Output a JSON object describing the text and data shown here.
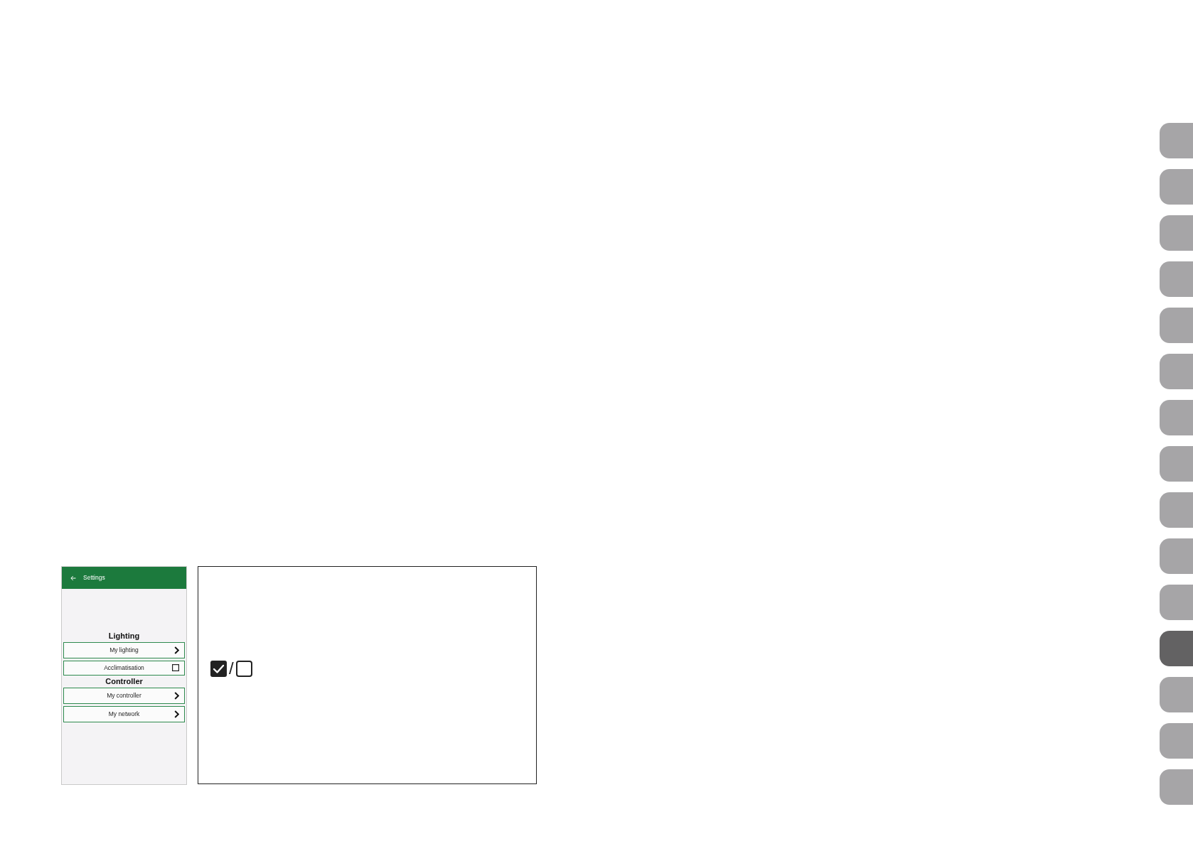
{
  "phone_screen": {
    "header": {
      "title": "Settings"
    },
    "sections": [
      {
        "heading": "Lighting",
        "items": [
          {
            "kind": "link",
            "label": "My lighting"
          },
          {
            "kind": "checkbox",
            "label": "Acclimatisation",
            "checked": false
          }
        ]
      },
      {
        "heading": "Controller",
        "items": [
          {
            "kind": "link",
            "label": "My controller"
          },
          {
            "kind": "link",
            "label": "My network"
          }
        ]
      }
    ]
  },
  "legend_box": {
    "checkbox_states": [
      {
        "checked": true
      },
      {
        "checked": false
      }
    ],
    "separator": "/"
  },
  "side_tabs": [
    {
      "selected": false
    },
    {
      "selected": false
    },
    {
      "selected": false
    },
    {
      "selected": false
    },
    {
      "selected": false
    },
    {
      "selected": false
    },
    {
      "selected": false
    },
    {
      "selected": false
    },
    {
      "selected": false
    },
    {
      "selected": false
    },
    {
      "selected": false
    },
    {
      "selected": true
    },
    {
      "selected": false
    },
    {
      "selected": false
    },
    {
      "selected": false
    }
  ]
}
